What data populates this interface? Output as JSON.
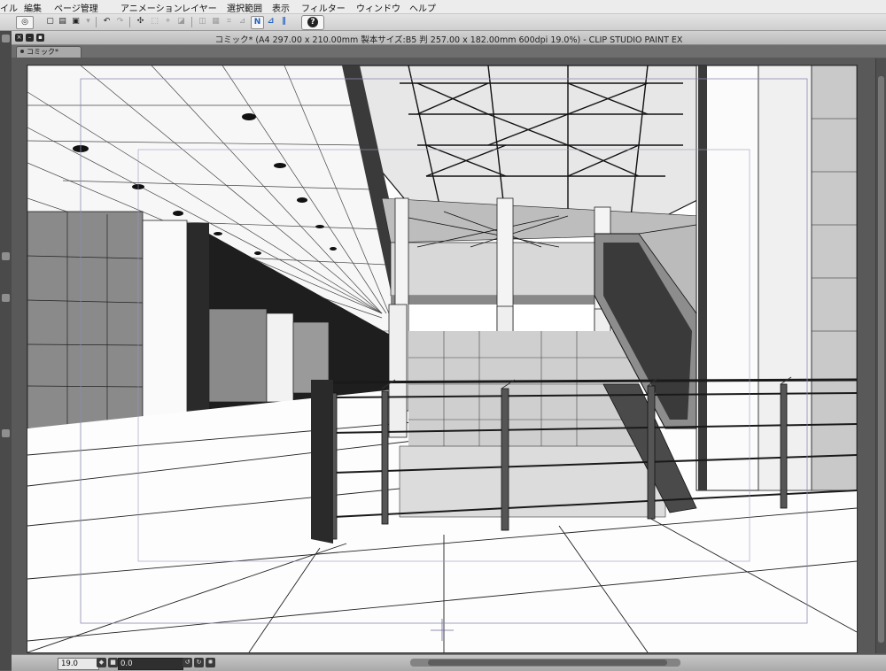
{
  "menu": {
    "file": "イル",
    "edit": "編集",
    "page": "ページ管理",
    "animation": "アニメーション",
    "layer": "レイヤー",
    "selection": "選択範囲",
    "view": "表示",
    "filter": "フィルター",
    "window": "ウィンドウ",
    "help": "ヘルプ"
  },
  "toolbar": {
    "icons": [
      "clip-studio-icon",
      "new-file-icon",
      "open-file-icon",
      "save-icon",
      "undo-icon",
      "redo-icon",
      "transform-icon",
      "select-all-icon",
      "fill-icon",
      "snap-icon",
      "perspective-icon",
      "ruler-icon",
      "guide-icon",
      "help-icon"
    ]
  },
  "window": {
    "title": "コミック* (A4 297.00 x 210.00mm 製本サイズ:B5 判 257.00 x 182.00mm 600dpi 19.0%) - CLIP STUDIO PAINT EX",
    "tab": "コミック*"
  },
  "status": {
    "zoom": "19.0",
    "angle": "0.0"
  },
  "colors": {
    "menubar": "#ececec",
    "toolbar": "#d9d9d9",
    "workspace": "#595959",
    "accent": "#1f5fbf"
  }
}
